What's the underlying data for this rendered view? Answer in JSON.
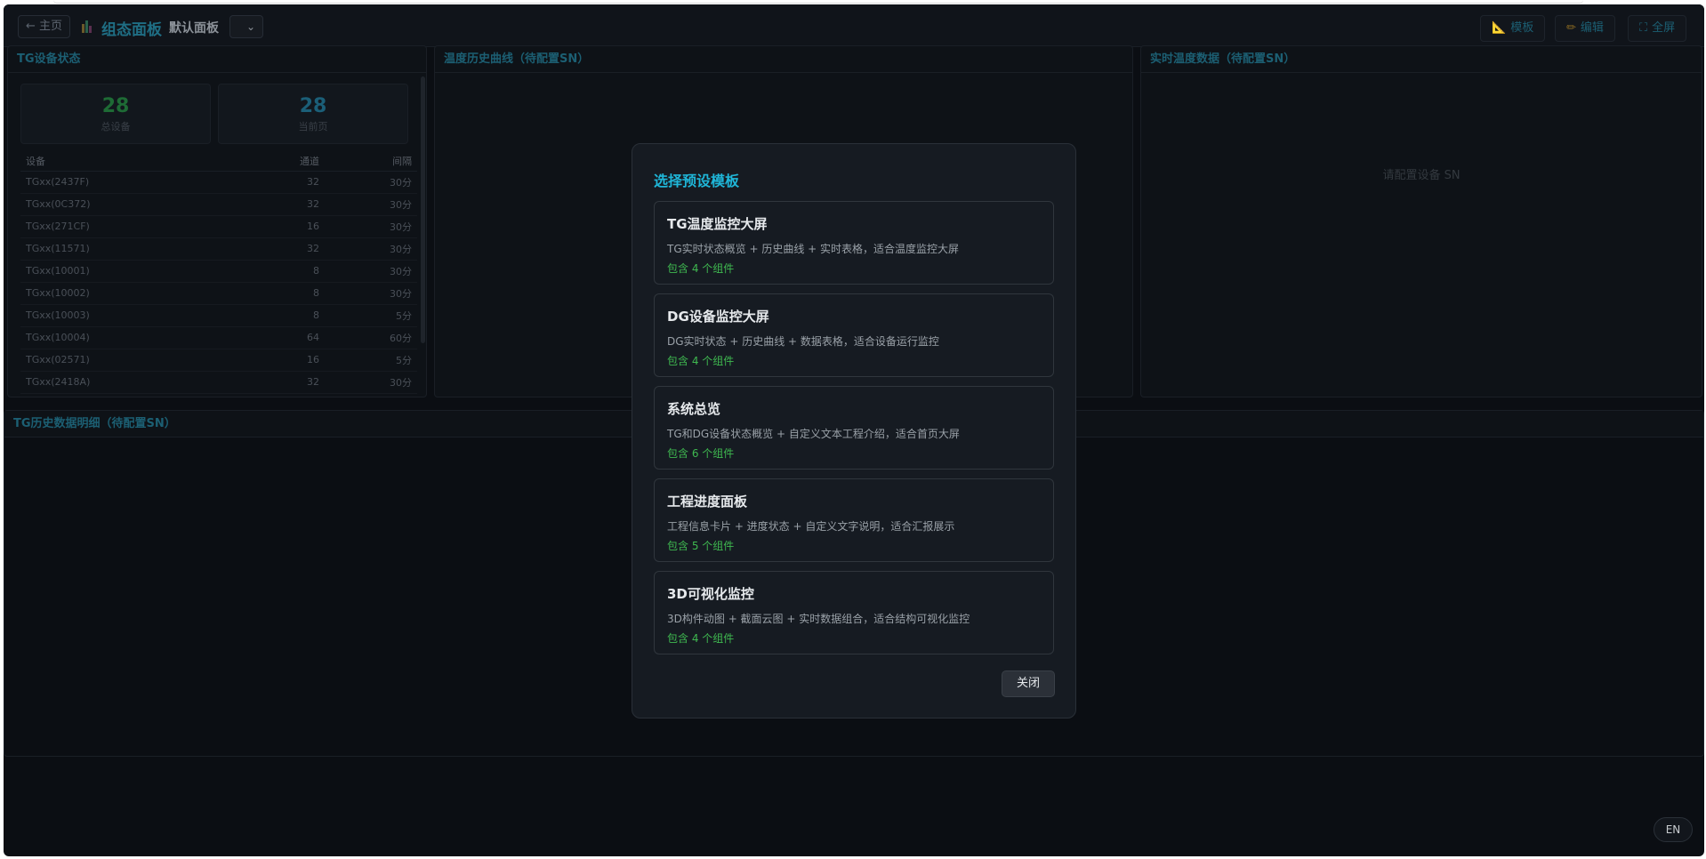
{
  "header": {
    "home_label": "← 主页",
    "title": "组态面板",
    "board_name": "默认面板",
    "board_select_caret": "⌄",
    "buttons": [
      {
        "icon": "ruler-icon",
        "glyph": "📐",
        "label": "模板"
      },
      {
        "icon": "pencil-icon",
        "glyph": "✏",
        "label": "编辑"
      },
      {
        "icon": "fullscreen-icon",
        "glyph": "⛶",
        "label": "全屏"
      }
    ]
  },
  "tg_status": {
    "title": "TG设备状态",
    "stats": [
      {
        "value": "28",
        "label": "总设备",
        "color": "#1e6b35"
      },
      {
        "value": "28",
        "label": "当前页",
        "color": "#1b5f78"
      }
    ],
    "columns": [
      "设备",
      "通道",
      "间隔"
    ],
    "rows": [
      [
        "TGxx(2437F)",
        "32",
        "30分"
      ],
      [
        "TGxx(0C372)",
        "32",
        "30分"
      ],
      [
        "TGxx(271CF)",
        "16",
        "30分"
      ],
      [
        "TGxx(11571)",
        "32",
        "30分"
      ],
      [
        "TGxx(10001)",
        "8",
        "30分"
      ],
      [
        "TGxx(10002)",
        "8",
        "30分"
      ],
      [
        "TGxx(10003)",
        "8",
        "5分"
      ],
      [
        "TGxx(10004)",
        "64",
        "60分"
      ],
      [
        "TGxx(02571)",
        "16",
        "5分"
      ],
      [
        "TGxx(2418A)",
        "32",
        "30分"
      ]
    ]
  },
  "temp_curve": {
    "title": "温度历史曲线（待配置SN）"
  },
  "realtime": {
    "title": "实时温度数据（待配置SN）",
    "placeholder": "请配置设备 SN"
  },
  "history": {
    "title": "TG历史数据明细（待配置SN）"
  },
  "modal": {
    "title": "选择预设模板",
    "templates": [
      {
        "name": "TG温度监控大屏",
        "desc": "TG实时状态概览 + 历史曲线 + 实时表格，适合温度监控大屏",
        "count": "包含 4 个组件"
      },
      {
        "name": "DG设备监控大屏",
        "desc": "DG实时状态 + 历史曲线 + 数据表格，适合设备运行监控",
        "count": "包含 4 个组件"
      },
      {
        "name": "系统总览",
        "desc": "TG和DG设备状态概览 + 自定义文本工程介绍，适合首页大屏",
        "count": "包含 6 个组件"
      },
      {
        "name": "工程进度面板",
        "desc": "工程信息卡片 + 进度状态 + 自定义文字说明，适合汇报展示",
        "count": "包含 5 个组件"
      },
      {
        "name": "3D可视化监控",
        "desc": "3D构件动图 + 截面云图 + 实时数据组合，适合结构可视化监控",
        "count": "包含 4 个组件"
      }
    ],
    "close_label": "关闭"
  },
  "lang_button": "EN"
}
